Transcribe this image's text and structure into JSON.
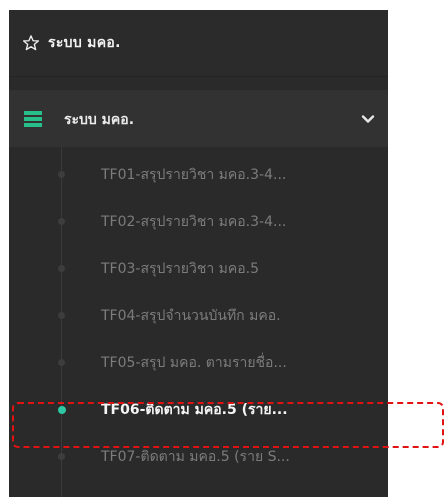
{
  "header": {
    "title": "ระบบ มคอ.",
    "icon": "star-icon"
  },
  "section": {
    "label": "ระบบ มคอ.",
    "icon": "menu-icon",
    "expand_icon": "chevron-down-icon",
    "accent_color": "#27c08b"
  },
  "items": [
    {
      "label": "TF01-สรุปรายวิชา มคอ.3-4..."
    },
    {
      "label": "TF02-สรุปรายวิชา มคอ.3-4..."
    },
    {
      "label": "TF03-สรุปรายวิชา มคอ.5"
    },
    {
      "label": "TF04-สรุปจำนวนบันทึก มคอ."
    },
    {
      "label": "TF05-สรุป มคอ. ตามรายชื่อ..."
    },
    {
      "label": "TF06-ติดตาม มคอ.5 (ราย..."
    },
    {
      "label": "TF07-ติดตาม มคอ.5 (ราย S..."
    }
  ],
  "active_item_index": 5,
  "highlight_color": "#e01212"
}
